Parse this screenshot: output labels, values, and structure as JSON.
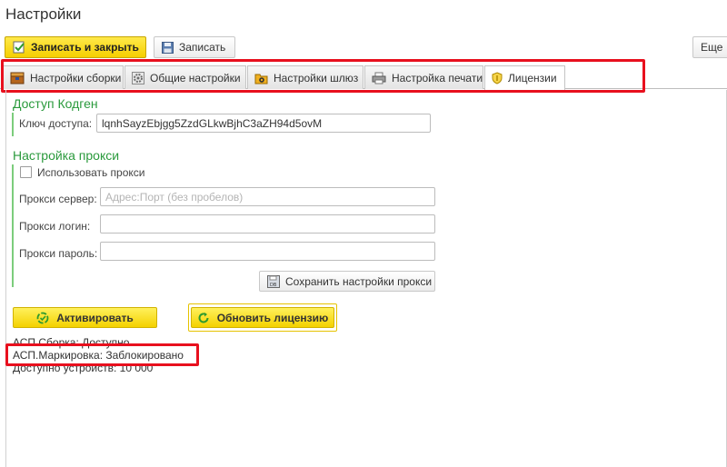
{
  "window": {
    "title": "Настройки"
  },
  "toolbar": {
    "save_close_label": "Записать и закрыть",
    "save_label": "Записать",
    "more_label": "Еще"
  },
  "tabs": [
    {
      "label": "Настройки сборки",
      "icon": "assembly-box-icon"
    },
    {
      "label": "Общие настройки",
      "icon": "gear-icon"
    },
    {
      "label": "Настройки шлюз",
      "icon": "gateway-icon"
    },
    {
      "label": "Настройка печати",
      "icon": "printer-icon"
    },
    {
      "label": "Лицензии",
      "icon": "license-shield-icon",
      "active": true
    }
  ],
  "kodgen": {
    "title": "Доступ Кодген",
    "key_label": "Ключ доступа:",
    "key_value": "lqnhSayzEbjgg5ZzdGLkwBjhC3aZH94d5ovM"
  },
  "proxy": {
    "title": "Настройка прокси",
    "use_proxy_label": "Использовать прокси",
    "use_proxy_checked": false,
    "server_label": "Прокси сервер:",
    "server_placeholder": "Адрес:Порт (без пробелов)",
    "server_value": "",
    "login_label": "Прокси логин:",
    "login_value": "",
    "password_label": "Прокси пароль:",
    "password_value": "",
    "save_button_label": "Сохранить настройки прокси"
  },
  "actions": {
    "activate_label": "Активировать",
    "refresh_label": "Обновить лицензию"
  },
  "status": {
    "assembly": "АСП.Сборка: Доступно",
    "marking": "АСП.Маркировка: Заблокировано",
    "devices": "Доступно устройств: 10 000"
  },
  "colors": {
    "accent_yellow": "#f5cf00",
    "section_green": "#2a9a3c",
    "highlight_red": "#e8101e"
  }
}
